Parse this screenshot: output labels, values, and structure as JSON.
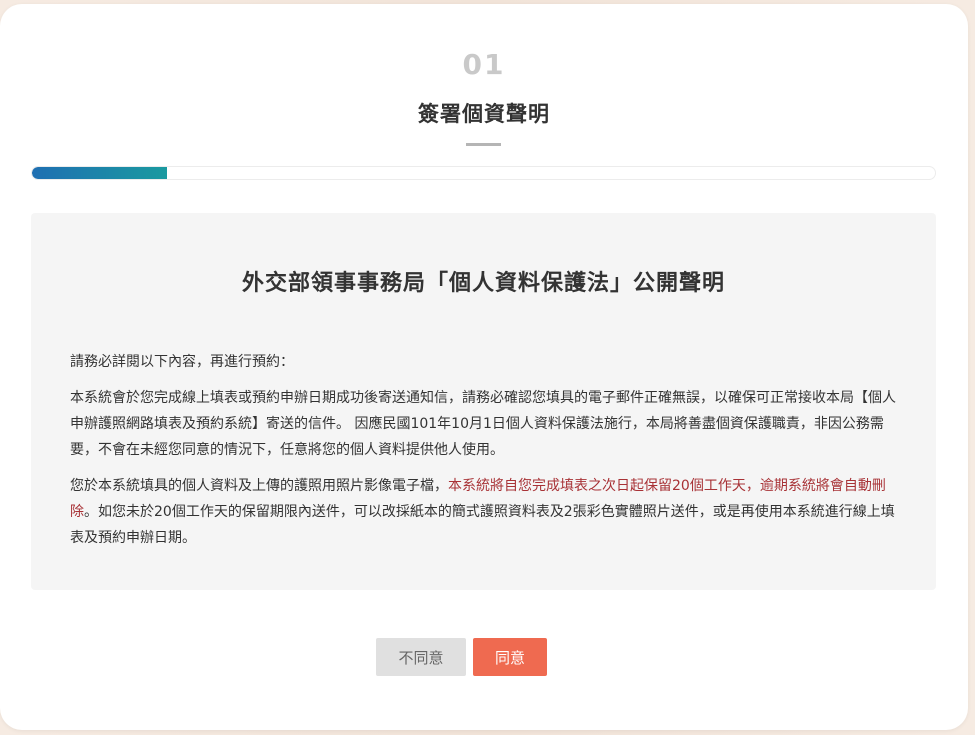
{
  "step": {
    "number": "01",
    "title": "簽署個資聲明",
    "progress_fraction": 0.15
  },
  "declaration": {
    "title": "外交部領事事務局「個人資料保護法」公開聲明",
    "intro": "請務必詳閱以下內容，再進行預約：",
    "paragraph1": "本系統會於您完成線上填表或預約申辦日期成功後寄送通知信，請務必確認您填具的電子郵件正確無誤，以確保可正常接收本局【個人申辦護照網路填表及預約系統】寄送的信件。 因應民國101年10月1日個人資料保護法施行，本局將善盡個資保護職責，非因公務需要，不會在未經您同意的情況下，任意將您的個人資料提供他人使用。",
    "paragraph2_before": "您於本系統填具的個人資料及上傳的護照用照片影像電子檔，",
    "paragraph2_highlight": "本系統將自您完成填表之次日起保留20個工作天，逾期系統將會自動刪除",
    "paragraph2_after": "。如您未於20個工作天的保留期限內送件，可以改採紙本的簡式護照資料表及2張彩色實體照片送件，或是再使用本系統進行線上填表及預約申辦日期。"
  },
  "buttons": {
    "disagree_label": "不同意",
    "agree_label": "同意"
  },
  "colors": {
    "accent": "#ef6a50",
    "highlight_text": "#a83236",
    "progress_start": "#1f6fb2",
    "progress_end": "#1a9aa0"
  }
}
